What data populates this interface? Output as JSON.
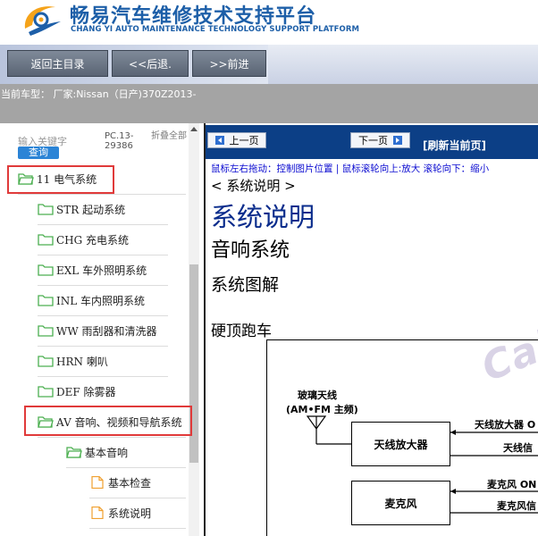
{
  "header": {
    "title_cn": "畅易汽车维修技术支持平台",
    "title_en": "CHANG YI AUTO MAINTENANCE TECHNOLOGY SUPPORT PLATFORM"
  },
  "nav": {
    "home": "返回主目录",
    "back": "<<后退.",
    "forward": ">>前进"
  },
  "car": {
    "current": "当前车型： 厂家:Nissan（日产)370Z2013-"
  },
  "search": {
    "label": "输入关键字",
    "button": "查询",
    "pc_code": "PC.13-29386",
    "collapse_all": "折叠全部"
  },
  "tree": [
    {
      "label": "11 电气系统",
      "type": "folder-open"
    },
    {
      "label": "STR 起动系统",
      "type": "folder"
    },
    {
      "label": "CHG 充电系统",
      "type": "folder"
    },
    {
      "label": "EXL 车外照明系统",
      "type": "folder"
    },
    {
      "label": "INL 车内照明系统",
      "type": "folder"
    },
    {
      "label": "WW 雨刮器和清洗器",
      "type": "folder"
    },
    {
      "label": "HRN 喇叭",
      "type": "folder"
    },
    {
      "label": "DEF 除雾器",
      "type": "folder"
    },
    {
      "label": "AV 音响、视频和导航系统",
      "type": "folder-open"
    },
    {
      "label": "基本音响",
      "type": "folder-open"
    },
    {
      "label": "基本检查",
      "type": "page"
    },
    {
      "label": "系统说明",
      "type": "page"
    }
  ],
  "pager": {
    "prev": "上一页",
    "next": "下一页",
    "refresh": "[刷新当前页]",
    "hint": "鼠标左右拖动：控制图片位置 | 鼠标滚轮向上:放大  滚轮向下：缩小"
  },
  "doc": {
    "breadcrumb": "< 系统说明 >",
    "title": "系统说明",
    "section": "音响系统",
    "subsection": "系统图解",
    "variant": "硬顶跑车"
  },
  "diagram": {
    "antenna_label_1": "玻璃天线",
    "antenna_label_2": "(AM•FM 主频)",
    "box_amp": "天线放大器",
    "box_mic": "麦克风",
    "right_label_1": "天线放大器 O",
    "right_label_2": "天线信",
    "right_label_3": "麦克风 ON",
    "right_label_4": "麦克风信",
    "watermark": "Cal"
  },
  "colors": {
    "brand_blue": "#1d5fa8",
    "highlight_red": "#e03a3a",
    "toolbar_blue": "#0c3f86"
  }
}
